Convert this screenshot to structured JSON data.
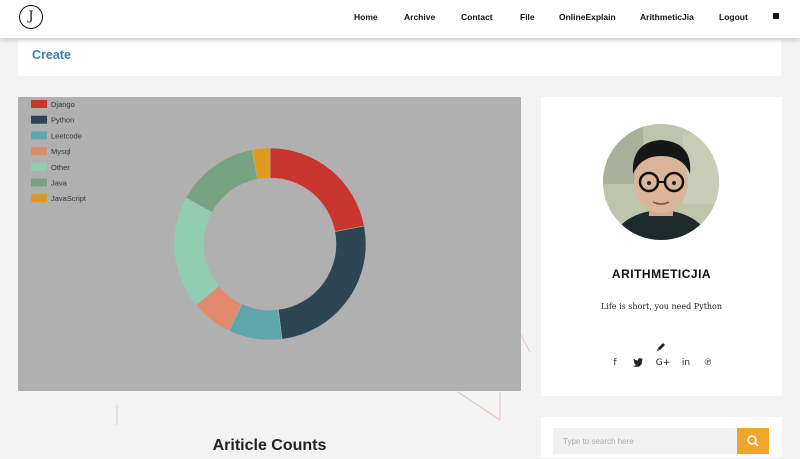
{
  "nav": {
    "logo": "J",
    "items": [
      "Home",
      "Archive",
      "Contact",
      "File",
      "OnlineExplain",
      "ArithmeticJia",
      "Logout"
    ]
  },
  "page": {
    "title": "Create",
    "section_heading": "Ariticle Counts"
  },
  "chart_data": {
    "type": "pie",
    "variant": "doughnut",
    "title": "",
    "legend_position": "top-left",
    "labels": [
      "Django",
      "Python",
      "Leetcode",
      "Mysql",
      "Other",
      "Java",
      "JavaScript"
    ],
    "values": [
      22,
      26,
      9,
      7,
      19,
      14,
      3
    ],
    "colors": [
      "#c8352f",
      "#2e4553",
      "#5ea5ac",
      "#e08b6e",
      "#92cdb1",
      "#78a383",
      "#de9a1e"
    ]
  },
  "profile": {
    "name": "ARITHMETICJIA",
    "motto": "Life is short, you need Python",
    "edit_icon": "pencil-icon",
    "social": [
      {
        "name": "facebook-icon",
        "glyph": "f"
      },
      {
        "name": "twitter-icon",
        "glyph": "🐦"
      },
      {
        "name": "google-plus-icon",
        "glyph": "G+"
      },
      {
        "name": "linkedin-icon",
        "glyph": "in"
      },
      {
        "name": "pinterest-icon",
        "glyph": "℗"
      }
    ]
  },
  "search": {
    "placeholder": "Type to search here",
    "button_icon": "search-icon"
  },
  "colors": {
    "accent_title": "#3c7fa6",
    "search_button": "#f0a62a",
    "chart_background": "#b0b0b0"
  }
}
